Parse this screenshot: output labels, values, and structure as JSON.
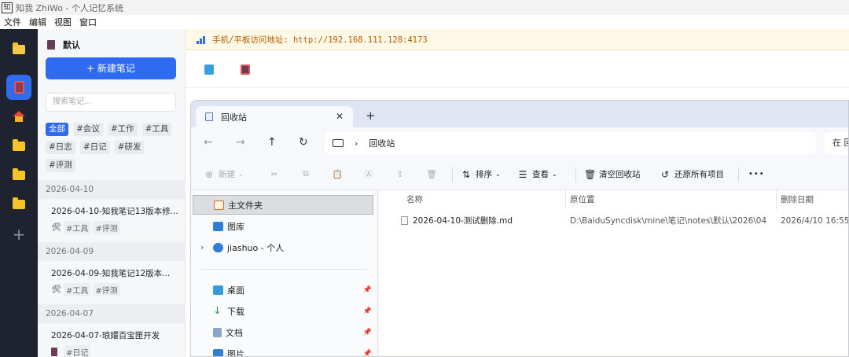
{
  "window": {
    "title": "知我 ZhiWo - 个人记忆系统",
    "logo_text": "知"
  },
  "menu": [
    "文件",
    "编辑",
    "视图",
    "窗口"
  ],
  "rail": {
    "add_symbol": "+"
  },
  "sidebar": {
    "notebook_name": "默认",
    "new_note_label": "+ 新建笔记",
    "search_placeholder": "搜索笔记...",
    "tags": [
      "全部",
      "#会议",
      "#工作",
      "#工具",
      "#日志",
      "#日记",
      "#研发",
      "#评测"
    ],
    "groups": [
      {
        "date": "2026-04-10",
        "note": {
          "title": "2026-04-10-知我笔记13版本修...",
          "tags": [
            "#工具",
            "#评测"
          ]
        }
      },
      {
        "date": "2026-04-09",
        "note": {
          "title": "2026-04-09-知我笔记12版本...",
          "tags": [
            "#工具",
            "#评测"
          ]
        }
      },
      {
        "date": "2026-04-07",
        "note": {
          "title": "2026-04-07-琅嬛百宝匣开发",
          "tags": [
            "#日记"
          ]
        }
      }
    ]
  },
  "banner": {
    "text": "手机/平板访问地址: http://192.168.111.128:4173"
  },
  "explorer": {
    "tab_label": "回收站",
    "tab_close": "✕",
    "new_tab": "+",
    "address": "回收站",
    "search_placeholder": "在 回",
    "commands": {
      "new": "新建",
      "sort": "排序",
      "view": "查看",
      "empty": "清空回收站",
      "restore_all": "还原所有项目",
      "more": "•••"
    },
    "nav": {
      "home": "主文件夹",
      "gallery": "图库",
      "cloud": "jiashuo - 个人",
      "desktop": "桌面",
      "downloads": "下载",
      "documents": "文档",
      "pictures": "图片"
    },
    "columns": [
      "名称",
      "原位置",
      "删除日期"
    ],
    "files": [
      {
        "name": "2026-04-10-测试删除.md",
        "location": "D:\\BaiduSyncdisk\\mine\\笔记\\notes\\默认\\2026\\04",
        "deleted": "2026/4/10 16:55"
      }
    ]
  },
  "colors": {
    "accent": "#2f6bf0",
    "rail": "#1f2330",
    "banner_bg": "#fff8e6",
    "banner_text": "#b85c00"
  }
}
